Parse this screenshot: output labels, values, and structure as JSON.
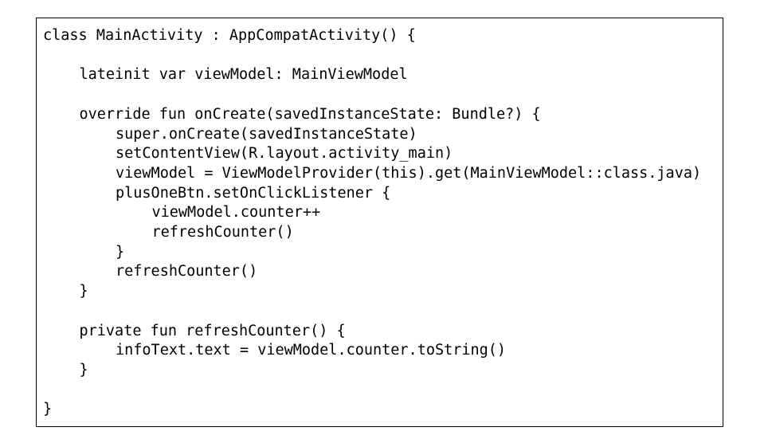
{
  "code_lines": [
    {
      "text": "class MainActivity : AppCompatActivity() {",
      "indent": 0
    },
    {
      "text": "",
      "indent": 0
    },
    {
      "text": "lateinit var viewModel: MainViewModel",
      "indent": 1
    },
    {
      "text": "",
      "indent": 0
    },
    {
      "text": "override fun onCreate(savedInstanceState: Bundle?) {",
      "indent": 1
    },
    {
      "text": "super.onCreate(savedInstanceState)",
      "indent": 2
    },
    {
      "text": "setContentView(R.layout.activity_main)",
      "indent": 2
    },
    {
      "text": "viewModel = ViewModelProvider(this).get(MainViewModel::class.java)",
      "indent": 2
    },
    {
      "text": "plusOneBtn.setOnClickListener {",
      "indent": 2
    },
    {
      "text": "viewModel.counter++",
      "indent": 3
    },
    {
      "text": "refreshCounter()",
      "indent": 3
    },
    {
      "text": "}",
      "indent": 2
    },
    {
      "text": "refreshCounter()",
      "indent": 2
    },
    {
      "text": "}",
      "indent": 1
    },
    {
      "text": "",
      "indent": 0
    },
    {
      "text": "private fun refreshCounter() {",
      "indent": 1
    },
    {
      "text": "infoText.text = viewModel.counter.toString()",
      "indent": 2
    },
    {
      "text": "}",
      "indent": 1
    },
    {
      "text": "",
      "indent": 0
    },
    {
      "text": "}",
      "indent": 0
    }
  ]
}
